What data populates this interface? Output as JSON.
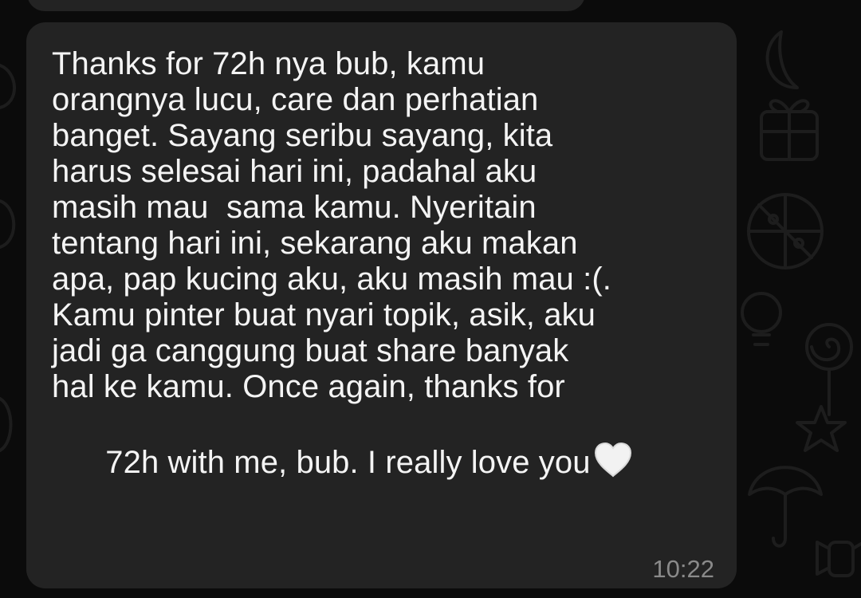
{
  "chat": {
    "previous_message": {
      "visible": true
    },
    "message": {
      "lines": [
        "Thanks for 72h nya bub, kamu",
        "orangnya lucu, care dan perhatian",
        "banget. Sayang seribu sayang, kita",
        "harus selesai hari ini, padahal aku",
        "masih mau  sama kamu. Nyeritain",
        "tentang hari ini, sekarang aku makan",
        "apa, pap kucing aku, aku masih mau :(.",
        "Kamu pinter buat nyari topik, asik, aku",
        "jadi ga canggung buat share banyak",
        "hal ke kamu. Once again, thanks for",
        "72h with me, bub. I really love you"
      ],
      "emoji": "white-heart-icon",
      "time": "10:22"
    }
  },
  "colors": {
    "background": "#0b0b0b",
    "bubble": "#232323",
    "text": "#f4f4f4",
    "timestamp": "#8a8a8a",
    "wallpaper_doodles": "#1b1b1b"
  }
}
